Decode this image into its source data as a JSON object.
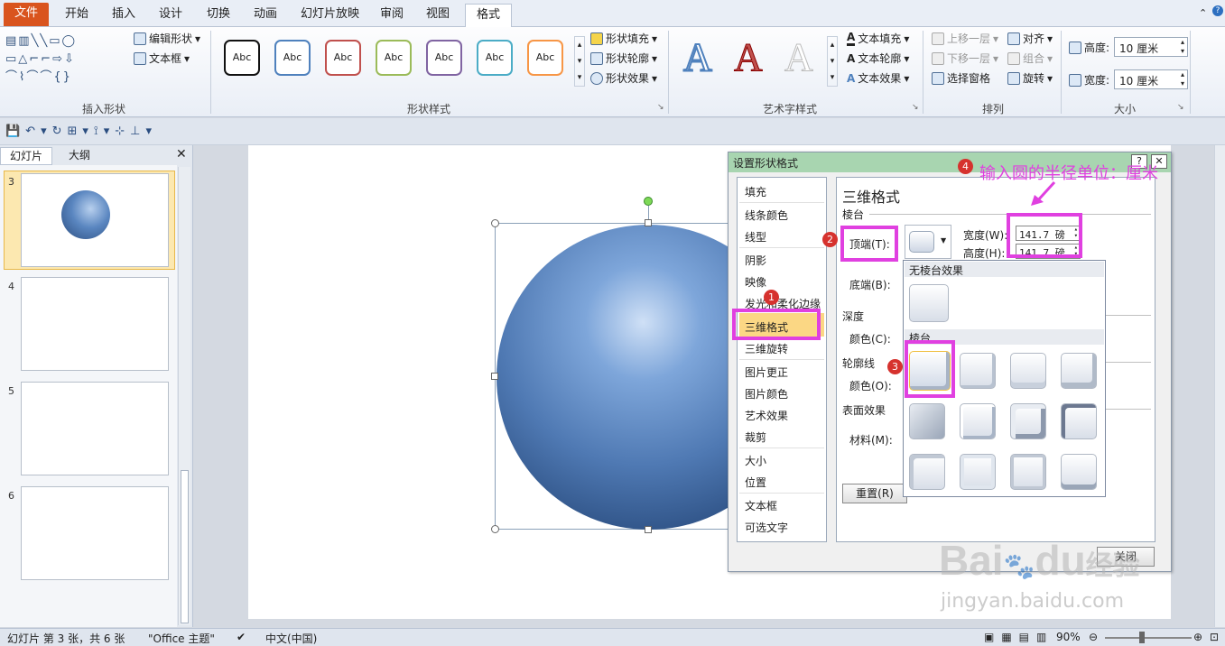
{
  "tabs": [
    {
      "label": "文件"
    },
    {
      "label": "开始"
    },
    {
      "label": "插入"
    },
    {
      "label": "设计"
    },
    {
      "label": "切换"
    },
    {
      "label": "动画"
    },
    {
      "label": "幻灯片放映"
    },
    {
      "label": "审阅"
    },
    {
      "label": "视图"
    },
    {
      "label": "格式"
    }
  ],
  "ribbon": {
    "insert_shapes": {
      "edit_shape": "编辑形状",
      "textbox": "文本框",
      "label": "插入形状"
    },
    "shape_styles": {
      "sample": "Abc",
      "fill": "形状填充",
      "outline": "形状轮廓",
      "effects": "形状效果",
      "label": "形状样式"
    },
    "wordart": {
      "letter": "A",
      "text_fill": "文本填充",
      "text_outline": "文本轮廓",
      "text_effects": "文本效果",
      "label": "艺术字样式"
    },
    "arrange": {
      "bring_forward": "上移一层",
      "send_backward": "下移一层",
      "selection_pane": "选择窗格",
      "align": "对齐",
      "group": "组合",
      "rotate": "旋转",
      "label": "排列"
    },
    "size": {
      "height_label": "高度:",
      "height_value": "10 厘米",
      "width_label": "宽度:",
      "width_value": "10 厘米",
      "label": "大小"
    }
  },
  "left_panel": {
    "tab_slides": "幻灯片",
    "tab_outline": "大纲",
    "thumbs": [
      {
        "num": "3"
      },
      {
        "num": "4"
      },
      {
        "num": "5"
      },
      {
        "num": "6"
      }
    ]
  },
  "dialog": {
    "title": "设置形状格式",
    "help": "?",
    "close": "✕",
    "nav": [
      "填充",
      "线条颜色",
      "线型",
      "阴影",
      "映像",
      "发光和柔化边缘",
      "三维格式",
      "三维旋转",
      "图片更正",
      "图片颜色",
      "艺术效果",
      "裁剪",
      "大小",
      "位置",
      "文本框",
      "可选文字"
    ],
    "heading": "三维格式",
    "bevel": "棱台",
    "top_label": "顶端(T):",
    "bottom_label": "底端(B):",
    "width_label": "宽度(W):",
    "width_value": "141.7 磅",
    "height_label": "高度(H):",
    "height_value": "141.7 磅",
    "depth": "深度",
    "depth_color": "颜色(C):",
    "contour": "轮廓线",
    "contour_color": "颜色(O):",
    "surface": "表面效果",
    "material": "材料(M):",
    "reset": "重置(R)",
    "close_btn": "关闭",
    "popup_none": "无棱台效果",
    "popup_bevel": "棱台"
  },
  "annotation": {
    "text": "输入圆的半径单位：厘米",
    "badge1": "1",
    "badge2": "2",
    "badge3": "3",
    "badge4": "4",
    "color": "#e040e0"
  },
  "watermark": {
    "brand": "Bai",
    "brand2": "du",
    "brand_cn": "经验",
    "url": "jingyan.baidu.com"
  },
  "status": {
    "slide_info": "幻灯片 第 3 张，共 6 张",
    "theme": "\"Office 主题\"",
    "language": "中文(中国)",
    "zoom": "90%"
  }
}
